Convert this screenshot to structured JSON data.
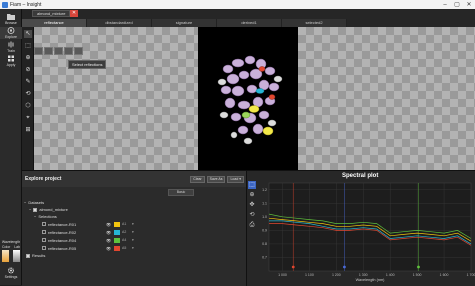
{
  "window": {
    "title": "Fiam – Insight",
    "minimize": "–",
    "maximize": "▢",
    "close": "✕"
  },
  "sidebar": {
    "items": [
      {
        "label": "Browse",
        "icon": "folder-icon"
      },
      {
        "label": "Explore",
        "icon": "compass-icon"
      },
      {
        "label": "Train",
        "icon": "brain-icon"
      },
      {
        "label": "Apply",
        "icon": "grid-icon"
      }
    ],
    "wavelength_label": "Wavelength",
    "swatch_labels": [
      "Color",
      "Lab"
    ],
    "settings_label": "Settings"
  },
  "file_tab": {
    "label": "almond_mixture",
    "close": "✕"
  },
  "view_tabs": [
    "reflectance",
    "dbstandardized",
    "signature",
    "derived1",
    "selected2"
  ],
  "active_view_tab": 0,
  "tools": [
    "↖",
    "⬚",
    "⊕",
    "⊘",
    "✎",
    "⟲",
    "⬡",
    "⌖",
    "⊞"
  ],
  "tooltip": "Select reflections",
  "explore": {
    "title": "Explore project",
    "buttons": [
      "Clear",
      "Save As",
      "Load ▾"
    ],
    "basic_label": "Basic",
    "tree": {
      "datasets": "Datasets",
      "dataset_name": "almond_mixture",
      "selections_label": "Selections",
      "selections": [
        {
          "name": "reflectance-R01",
          "color": "#f2c40f",
          "value": "A1"
        },
        {
          "name": "reflectance-R02",
          "color": "#26b6d4",
          "value": "A2"
        },
        {
          "name": "reflectance-R04",
          "color": "#5fc13d",
          "value": "A4"
        },
        {
          "name": "reflectance-R05",
          "color": "#e2462f",
          "value": "A5"
        }
      ],
      "results_label": "Results"
    }
  },
  "plot": {
    "title": "Spectral plot",
    "xlabel": "Wavelength (nm)"
  },
  "chart_data": {
    "type": "line",
    "title": "Spectral plot",
    "xlabel": "Wavelength (nm)",
    "ylabel": "",
    "xlim": [
      950,
      1700
    ],
    "ylim": [
      0.6,
      1.25
    ],
    "x_ticks": [
      "1 000",
      "1 100",
      "1 200",
      "1 300",
      "1 400",
      "1 500",
      "1 600",
      "1 700"
    ],
    "y_ticks": [
      "1.2",
      "1.1",
      "1.0",
      "0.9",
      "0.8",
      "0.7"
    ],
    "x": [
      950,
      1000,
      1050,
      1100,
      1150,
      1200,
      1250,
      1300,
      1350,
      1400,
      1450,
      1500,
      1550,
      1600,
      1650,
      1700
    ],
    "series": [
      {
        "color": "#f2c40f",
        "values": [
          0.99,
          0.98,
          0.97,
          0.96,
          0.95,
          0.93,
          0.93,
          0.94,
          0.93,
          0.86,
          0.87,
          0.88,
          0.87,
          0.86,
          0.88,
          0.82
        ]
      },
      {
        "color": "#26b6d4",
        "values": [
          0.97,
          0.97,
          0.96,
          0.95,
          0.93,
          0.91,
          0.91,
          0.92,
          0.91,
          0.84,
          0.85,
          0.86,
          0.85,
          0.84,
          0.86,
          0.8
        ]
      },
      {
        "color": "#5fc13d",
        "values": [
          1.02,
          1.0,
          0.99,
          0.98,
          0.97,
          0.95,
          0.95,
          0.96,
          0.95,
          0.88,
          0.89,
          0.9,
          0.89,
          0.88,
          0.9,
          0.84
        ]
      },
      {
        "color": "#e2462f",
        "values": [
          0.95,
          0.95,
          0.94,
          0.93,
          0.92,
          0.9,
          0.9,
          0.91,
          0.9,
          0.83,
          0.84,
          0.85,
          0.84,
          0.83,
          0.85,
          0.79
        ]
      }
    ],
    "markers": [
      {
        "x": 1040,
        "color": "#e2462f"
      },
      {
        "x": 1230,
        "color": "#4a6ad8"
      },
      {
        "x": 1505,
        "color": "#5fc13d"
      }
    ],
    "grid": true
  }
}
